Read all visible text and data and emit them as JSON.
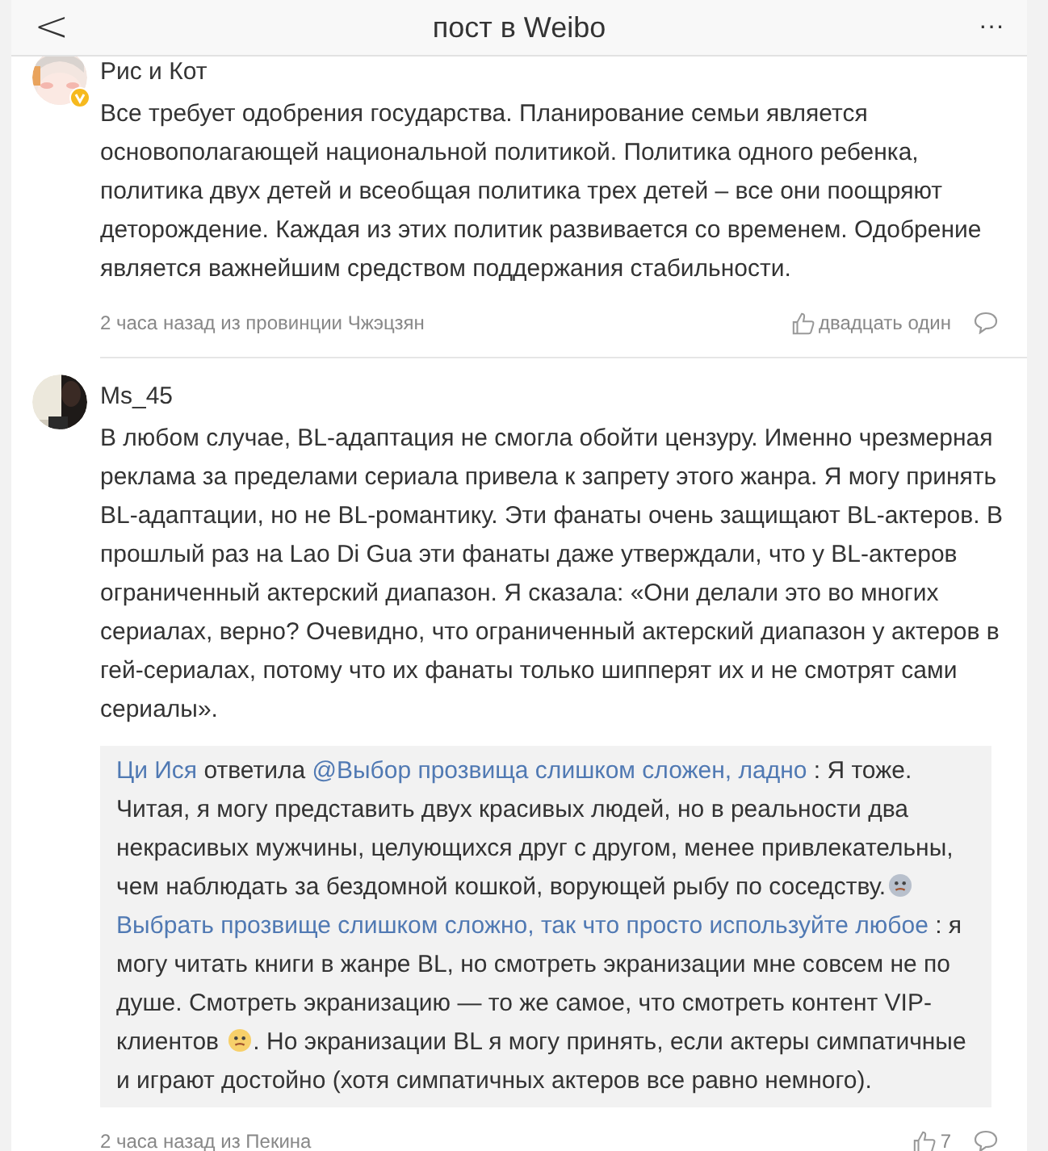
{
  "header": {
    "title": "пост в Weibo",
    "back": "<",
    "more": "···"
  },
  "comments": [
    {
      "user": "Рис и Кот",
      "verified": true,
      "text": "Все требует одобрения государства. Планирование семьи является основополагающей национальной политикой. Политика одного ребенка, политика двух детей и всеобщая политика трех детей – все они поощряют деторождение. Каждая из этих политик развивается со временем. Одобрение является важнейшим средством поддержания стабильности.",
      "meta": "2 часа назад из провинции Чжэцзян",
      "likes": "двадцать один"
    },
    {
      "user": "Ms_45",
      "verified": false,
      "text": "В любом случае, BL-адаптация не смогла обойти цензуру. Именно чрезмерная реклама за пределами сериала привела к запрету этого жанра. Я могу принять BL-адаптации, но не BL-романтику. Эти фанаты очень защищают BL-актеров. В прошлый раз на Lao Di Gua эти фанаты даже утверждали, что у BL-актеров ограниченный актерский диапазон. Я сказала: «Они делали это во многих сериалах, верно? Очевидно, что ограниченный актерский диапазон у актеров в гей-сериалах, потому что их фанаты только шипперят их и не смотрят сами сериалы».",
      "meta": "2 часа назад из Пекина",
      "likes": "7",
      "replies": [
        [
          {
            "kind": "link",
            "text": "Ци Ися"
          },
          {
            "kind": "text",
            "text": " ответила "
          },
          {
            "kind": "link",
            "text": "@Выбор прозвища слишком сложен, ладно"
          },
          {
            "kind": "text",
            "text": " : Я тоже. Читая, я могу представить двух красивых людей, но в реальности два некрасивых мужчины, целующихся друг с другом, менее привлекательны, чем наблюдать за бездомной кошкой, ворующей рыбу по соседству."
          },
          {
            "kind": "emoji"
          }
        ],
        [
          {
            "kind": "link",
            "text": "Выбрать прозвище слишком сложно, так что просто используйте любое"
          },
          {
            "kind": "text",
            "text": " : я могу читать книги в жанре BL, но смотреть экранизации мне совсем не по душе. Смотреть экранизацию — то же самое, что смотреть контент VIP-клиентов "
          },
          {
            "kind": "emoji"
          },
          {
            "kind": "text",
            "text": ". Но экранизации BL я могу принять, если актеры симпатичные и играют достойно (хотя симпатичных актеров все равно немного)."
          }
        ]
      ]
    }
  ]
}
